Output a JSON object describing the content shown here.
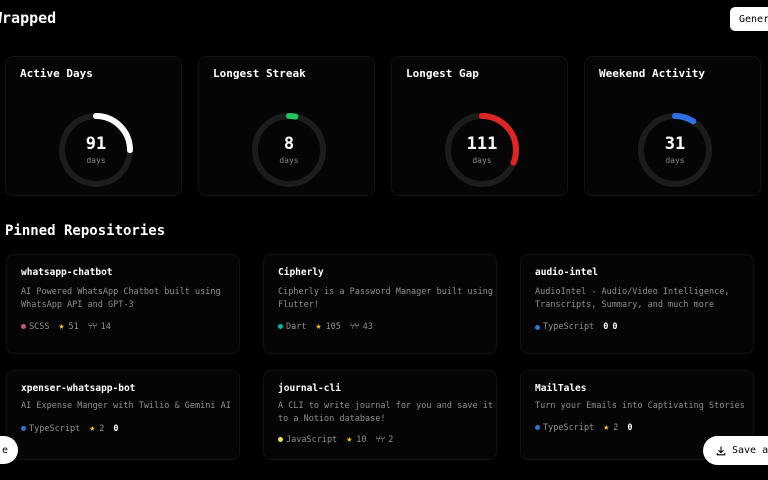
{
  "header": {
    "title": "Wrapped",
    "generate_label": "Generate"
  },
  "stats": [
    {
      "label": "Active Days",
      "value": "91",
      "unit": "days",
      "progress": 0.25,
      "start": 0.0,
      "color": "#ffffff"
    },
    {
      "label": "Longest Streak",
      "value": "8",
      "unit": "days",
      "progress": 0.03,
      "start": 0.0,
      "color": "#22c55e"
    },
    {
      "label": "Longest Gap",
      "value": "111",
      "unit": "days",
      "progress": 0.31,
      "start": 0.0,
      "color": "#dc2626"
    },
    {
      "label": "Weekend Activity",
      "value": "31",
      "unit": "days",
      "progress": 0.09,
      "start": 0.0,
      "color": "#2f6fe4"
    }
  ],
  "pinned": {
    "title": "Pinned Repositories",
    "repos": [
      {
        "name": "whatsapp-chatbot",
        "description": "AI Powered WhatsApp Chatbot built using WhatsApp API and GPT-3",
        "language": "SCSS",
        "language_color": "#c6538c",
        "stars": "51",
        "forks": "14"
      },
      {
        "name": "Cipherly",
        "description": "Cipherly is a Password Manager built using Flutter!",
        "language": "Dart",
        "language_color": "#00b4ab",
        "stars": "105",
        "forks": "43"
      },
      {
        "name": "audio-intel",
        "description": "AudioIntel - Audio/Video Intelligence, Transcripts, Summary, and much more",
        "language": "TypeScript",
        "language_color": "#3178c6",
        "stars": "0",
        "forks": "0"
      },
      {
        "name": "xpenser-whatsapp-bot",
        "description": "AI Expense Manger with Twilio & Gemini AI",
        "language": "TypeScript",
        "language_color": "#3178c6",
        "stars": "2",
        "forks": "0"
      },
      {
        "name": "journal-cli",
        "description": "A CLI to write journal for you and save it to a Notion database!",
        "language": "JavaScript",
        "language_color": "#f1e05a",
        "stars": "10",
        "forks": "2"
      },
      {
        "name": "MailTales",
        "description": "Turn your Emails into Captivating Stories",
        "language": "TypeScript",
        "language_color": "#3178c6",
        "stars": "2",
        "forks": "0"
      }
    ]
  },
  "footer": {
    "left_label": "e",
    "save_label": "Save as"
  },
  "icons": {
    "star": "star-icon",
    "fork": "fork-icon",
    "download": "download-icon"
  }
}
